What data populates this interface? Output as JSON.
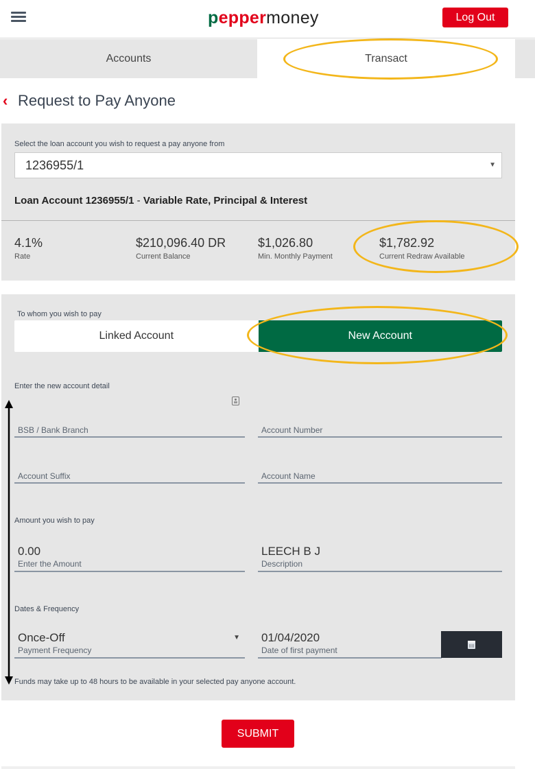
{
  "header": {
    "logo_part1_p": "p",
    "logo_part1_rest": "epper",
    "logo_part2": "money",
    "logout_label": "Log Out",
    "menu_icon": "hamburger-icon"
  },
  "tabs": [
    {
      "label": "Accounts",
      "active": false
    },
    {
      "label": "Transact",
      "active": true
    }
  ],
  "page": {
    "back_icon": "chevron-left-icon",
    "back_glyph": "‹",
    "title": "Request to Pay Anyone"
  },
  "loan": {
    "select_label": "Select the loan account you wish to request a pay anyone from",
    "selected_account": "1236955/1",
    "caret_glyph": "▼",
    "description_bold": "Loan Account 1236955/1",
    "description_rest": " - Variable Rate, Principal & Interest",
    "stats": [
      {
        "value": "4.1%",
        "label": "Rate"
      },
      {
        "value": "$210,096.40 DR",
        "label": "Current Balance"
      },
      {
        "value": "$1,026.80",
        "label": "Min. Monthly Payment"
      },
      {
        "value": "$1,782.92",
        "label": "Current Redraw Available"
      }
    ]
  },
  "payee": {
    "to_whom_label": "To whom you wish to pay",
    "options": [
      {
        "label": "Linked Account",
        "selected": false
      },
      {
        "label": "New Account",
        "selected": true
      }
    ],
    "new_account_heading": "Enter the new account detail",
    "fields": {
      "bsb": {
        "label": "BSB / Bank Branch",
        "value": ""
      },
      "account_number": {
        "label": "Account Number",
        "value": ""
      },
      "account_suffix": {
        "label": "Account Suffix",
        "value": ""
      },
      "account_name": {
        "label": "Account Name",
        "value": ""
      }
    },
    "amount_heading": "Amount you wish to pay",
    "amount": {
      "label": "Enter the Amount",
      "value": "0.00"
    },
    "description": {
      "label": "Description",
      "value": "LEECH B J"
    },
    "dates_heading": "Dates & Frequency",
    "frequency": {
      "label": "Payment Frequency",
      "value": "Once-Off"
    },
    "first_payment_date": {
      "label": "Date of first payment",
      "value": "01/04/2020"
    },
    "notice": "Funds may take up to 48 hours to be available in your selected pay anyone account."
  },
  "actions": {
    "submit_label": "SUBMIT"
  },
  "colors": {
    "brand_red": "#e2001a",
    "brand_green": "#006a43",
    "panel_gray": "#e6e6e6",
    "annotation_yellow": "#f3b61a",
    "calendar_button": "#272c34"
  }
}
